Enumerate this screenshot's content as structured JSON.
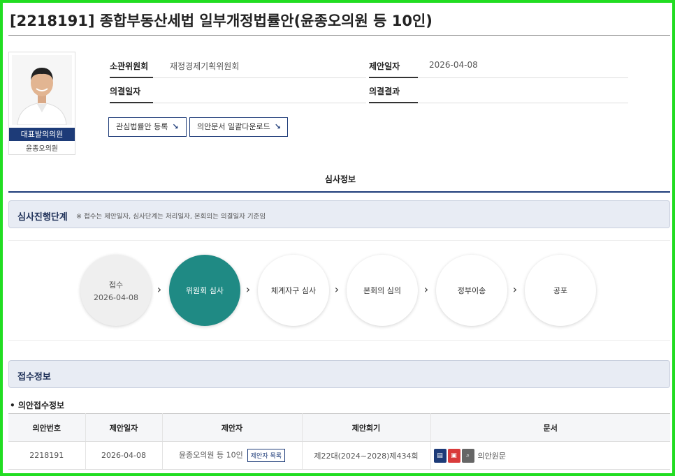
{
  "page": {
    "title": "[2218191] 종합부동산세법 일부개정법률안(윤종오의원 등 10인)"
  },
  "profile": {
    "badge": "대표발의의원",
    "name": "윤종오의원"
  },
  "info": {
    "committee_label": "소관위원회",
    "committee_value": "재정경제기획위원회",
    "propose_date_label": "제안일자",
    "propose_date_value": "2026-04-08",
    "resolution_date_label": "의결일자",
    "resolution_date_value": "",
    "resolution_result_label": "의결결과",
    "resolution_result_value": ""
  },
  "buttons": {
    "interest": "관심법률안 등록",
    "download": "의안문서 일괄다운로드",
    "arrow": "↘"
  },
  "tabs": {
    "review": "심사정보"
  },
  "stage_section": {
    "title": "심사진행단계",
    "note": "※ 접수는 제안일자, 심사단계는 처리일자, 본회의는 의결일자 기준임"
  },
  "steps": [
    {
      "label": "접수",
      "date": "2026-04-08",
      "state": "done"
    },
    {
      "label": "위원회 심사",
      "date": "",
      "state": "active"
    },
    {
      "label": "체계자구 심사",
      "date": "",
      "state": "pending"
    },
    {
      "label": "본회의 심의",
      "date": "",
      "state": "pending"
    },
    {
      "label": "정부이송",
      "date": "",
      "state": "pending"
    },
    {
      "label": "공포",
      "date": "",
      "state": "pending"
    }
  ],
  "receipt_section": {
    "title": "접수정보",
    "subhead": "• 의안접수정보"
  },
  "receipt_table": {
    "headers": [
      "의안번호",
      "제안일자",
      "제안자",
      "제안회기",
      "문서"
    ],
    "row": {
      "bill_no": "2218191",
      "date": "2026-04-08",
      "proposer": "윤종오의원 등 10인",
      "proposer_btn": "제안자 목록",
      "session": "제22대(2024~2028)제434회",
      "doc_label": "의안원문"
    }
  },
  "colors": {
    "accent": "#1d3b78",
    "active_step": "#1f8a84",
    "frame": "#22dd22"
  }
}
